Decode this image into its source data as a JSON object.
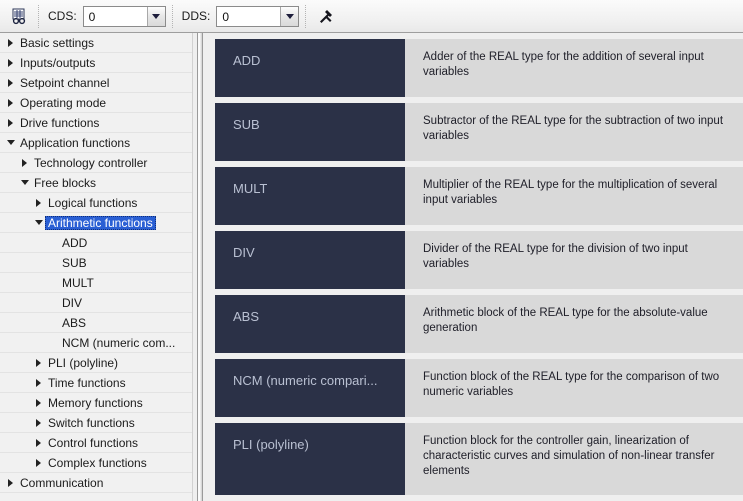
{
  "toolbar": {
    "inspect_icon": "table-inspect-icon",
    "tools_icon": "hammer-wrench-icon",
    "cds": {
      "label": "CDS:",
      "value": "0"
    },
    "dds": {
      "label": "DDS:",
      "value": "0"
    }
  },
  "tree": {
    "items": [
      {
        "label": "Basic settings",
        "indent": 0,
        "state": "collapsed",
        "selected": false
      },
      {
        "label": "Inputs/outputs",
        "indent": 0,
        "state": "collapsed",
        "selected": false
      },
      {
        "label": "Setpoint channel",
        "indent": 0,
        "state": "collapsed",
        "selected": false
      },
      {
        "label": "Operating mode",
        "indent": 0,
        "state": "collapsed",
        "selected": false
      },
      {
        "label": "Drive functions",
        "indent": 0,
        "state": "collapsed",
        "selected": false
      },
      {
        "label": "Application functions",
        "indent": 0,
        "state": "expanded",
        "selected": false
      },
      {
        "label": "Technology controller",
        "indent": 1,
        "state": "collapsed",
        "selected": false
      },
      {
        "label": "Free blocks",
        "indent": 1,
        "state": "expanded",
        "selected": false
      },
      {
        "label": "Logical functions",
        "indent": 2,
        "state": "collapsed",
        "selected": false
      },
      {
        "label": "Arithmetic functions",
        "indent": 2,
        "state": "expanded",
        "selected": true
      },
      {
        "label": "ADD",
        "indent": 3,
        "state": "leaf",
        "selected": false
      },
      {
        "label": "SUB",
        "indent": 3,
        "state": "leaf",
        "selected": false
      },
      {
        "label": "MULT",
        "indent": 3,
        "state": "leaf",
        "selected": false
      },
      {
        "label": "DIV",
        "indent": 3,
        "state": "leaf",
        "selected": false
      },
      {
        "label": "ABS",
        "indent": 3,
        "state": "leaf",
        "selected": false
      },
      {
        "label": "NCM (numeric com...",
        "indent": 3,
        "state": "leaf",
        "selected": false
      },
      {
        "label": "PLI (polyline)",
        "indent": 2,
        "state": "collapsed",
        "selected": false
      },
      {
        "label": "Time functions",
        "indent": 2,
        "state": "collapsed",
        "selected": false
      },
      {
        "label": "Memory functions",
        "indent": 2,
        "state": "collapsed",
        "selected": false
      },
      {
        "label": "Switch functions",
        "indent": 2,
        "state": "collapsed",
        "selected": false
      },
      {
        "label": "Control functions",
        "indent": 2,
        "state": "collapsed",
        "selected": false
      },
      {
        "label": "Complex functions",
        "indent": 2,
        "state": "collapsed",
        "selected": false
      },
      {
        "label": "Communication",
        "indent": 0,
        "state": "collapsed",
        "selected": false
      }
    ]
  },
  "cards": [
    {
      "name": "ADD",
      "description": "Adder of the REAL type for the addition of several input variables"
    },
    {
      "name": "SUB",
      "description": "Subtractor of the REAL type for the subtraction of two input variables"
    },
    {
      "name": "MULT",
      "description": "Multiplier of the REAL type for the multiplication of several input variables"
    },
    {
      "name": "DIV",
      "description": "Divider of the REAL type for the division of two input variables"
    },
    {
      "name": "ABS",
      "description": "Arithmetic block of the REAL type for the absolute-value generation"
    },
    {
      "name": "NCM (numeric compari...",
      "description": "Function block of the REAL type for the comparison of two numeric variables"
    },
    {
      "name": "PLI (polyline)",
      "description": "Function block for the controller gain, linearization of characteristic curves and simulation of non-linear transfer elements"
    }
  ],
  "colors": {
    "card_caption_bg": "#2b3147",
    "card_caption_text": "#b9c0d2",
    "card_desc_bg": "#d9d9d9",
    "selection_bg": "#2a5fd4",
    "panel_bg": "#efefef"
  }
}
